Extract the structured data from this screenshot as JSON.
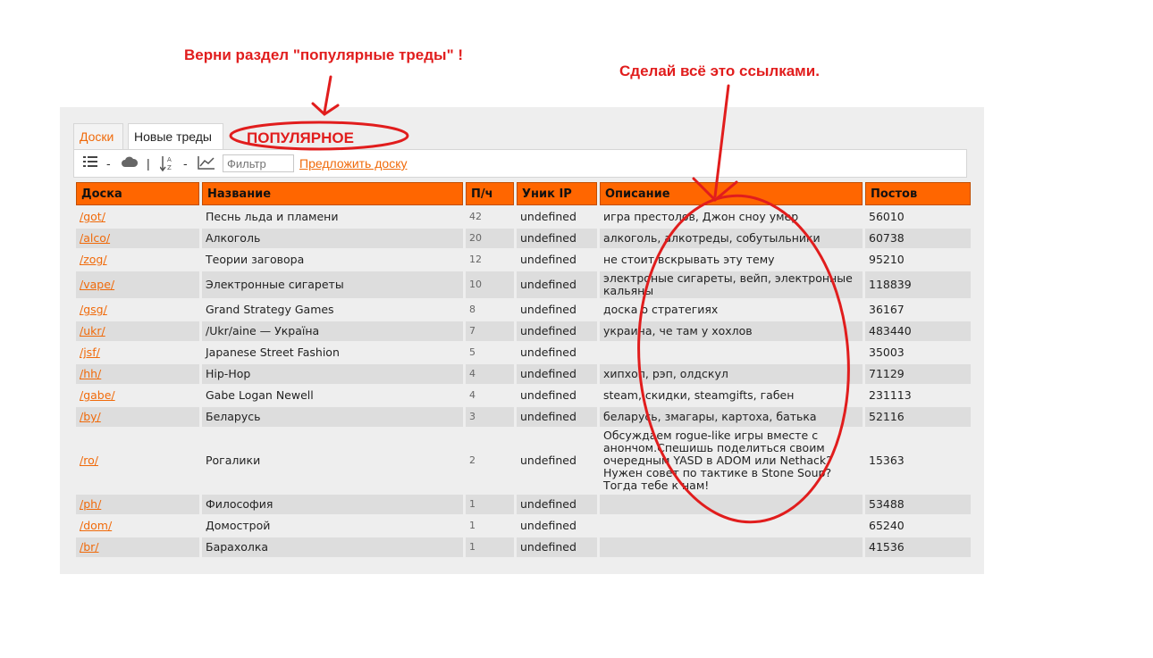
{
  "annotations": {
    "top_left": "Верни раздел \"популярные треды\" !",
    "top_right": "Сделай всё это ссылками.",
    "circled_tab": "ПОПУЛЯРНОЕ"
  },
  "colors": {
    "accent": "#ff6600",
    "link": "#f06a0a",
    "annotation": "#e11d1d"
  },
  "tabs": [
    {
      "label": "Доски",
      "active": false
    },
    {
      "label": "Новые треды",
      "active": true
    }
  ],
  "toolbar": {
    "icons": [
      "list-icon",
      "cloud-icon",
      "sort-az-icon",
      "chart-icon"
    ],
    "sep1": "-",
    "sep2": "|",
    "sep3": "-",
    "filter_placeholder": "Фильтр",
    "suggest_label": "Предложить доску"
  },
  "table": {
    "columns": [
      "Доска",
      "Название",
      "П/ч",
      "Уник IP",
      "Описание",
      "Постов"
    ],
    "rows": [
      {
        "board": "/got/",
        "name": "Песнь льда и пламени",
        "pph": "42",
        "ips": "undefined",
        "desc": "игра престолов, Джон сноу умер",
        "posts": "56010"
      },
      {
        "board": "/alco/",
        "name": "Алкоголь",
        "pph": "20",
        "ips": "undefined",
        "desc": "алкоголь, алкотреды, собутыльники",
        "posts": "60738"
      },
      {
        "board": "/zog/",
        "name": "Теории заговора",
        "pph": "12",
        "ips": "undefined",
        "desc": "не стоит вскрывать эту тему",
        "posts": "95210"
      },
      {
        "board": "/vape/",
        "name": "Электронные сигареты",
        "pph": "10",
        "ips": "undefined",
        "desc": "электроные сигареты, вейп, электронные кальяны",
        "posts": "118839"
      },
      {
        "board": "/gsg/",
        "name": "Grand Strategy Games",
        "pph": "8",
        "ips": "undefined",
        "desc": "доска о стратегиях",
        "posts": "36167"
      },
      {
        "board": "/ukr/",
        "name": "/Ukr/aine — Україна",
        "pph": "7",
        "ips": "undefined",
        "desc": "украина, че там у хохлов",
        "posts": "483440"
      },
      {
        "board": "/jsf/",
        "name": "Japanese Street Fashion",
        "pph": "5",
        "ips": "undefined",
        "desc": "",
        "posts": "35003"
      },
      {
        "board": "/hh/",
        "name": "Hip-Hop",
        "pph": "4",
        "ips": "undefined",
        "desc": "хипхоп, рэп, олдскул",
        "posts": "71129"
      },
      {
        "board": "/gabe/",
        "name": "Gabe Logan Newell",
        "pph": "4",
        "ips": "undefined",
        "desc": "steam, скидки, steamgifts, габен",
        "posts": "231113"
      },
      {
        "board": "/by/",
        "name": "Беларусь",
        "pph": "3",
        "ips": "undefined",
        "desc": "беларусь, змагары, картоха, батька",
        "posts": "52116"
      },
      {
        "board": "/ro/",
        "name": "Рогалики",
        "pph": "2",
        "ips": "undefined",
        "desc": "Обсуждаем rogue-like игры вместе с анончом.Спешишь поделиться своим очередным YASD в ADOM или Nethack? Нужен совет по тактике в Stone Soup? Тогда тебе к нам!",
        "posts": "15363"
      },
      {
        "board": "/ph/",
        "name": "Философия",
        "pph": "1",
        "ips": "undefined",
        "desc": "",
        "posts": "53488"
      },
      {
        "board": "/dom/",
        "name": "Домострой",
        "pph": "1",
        "ips": "undefined",
        "desc": "",
        "posts": "65240"
      },
      {
        "board": "/br/",
        "name": "Барахолка",
        "pph": "1",
        "ips": "undefined",
        "desc": "",
        "posts": "41536"
      }
    ]
  }
}
